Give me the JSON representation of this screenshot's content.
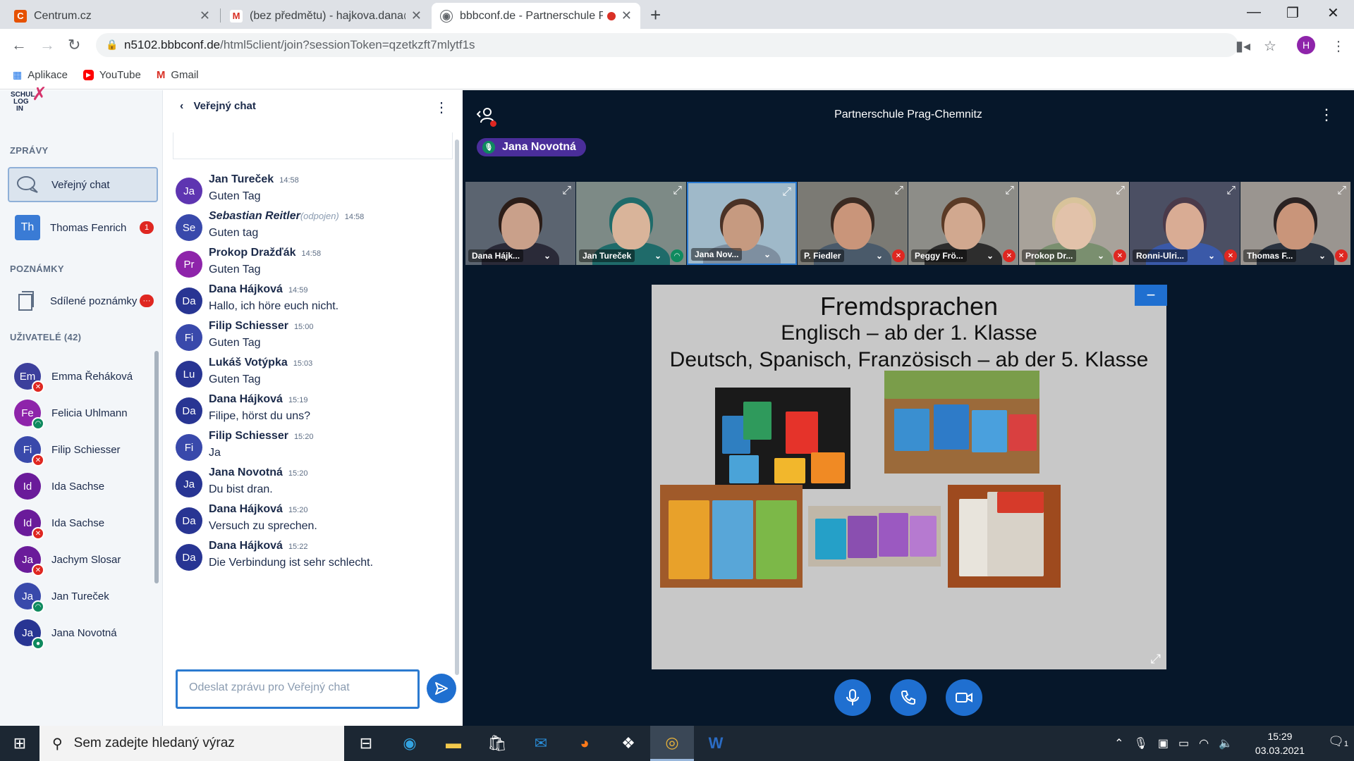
{
  "browser": {
    "tabs": [
      {
        "title": "Centrum.cz"
      },
      {
        "title": "(bez předmětu) - hajkova.dana@"
      },
      {
        "title": "bbbconf.de - Partnerschule P"
      }
    ],
    "url_host": "n5102.bbbconf.de",
    "url_path": "/html5client/join?sessionToken=qzetkzft7mlytf1s",
    "profile_initial": "H",
    "bookmarks": [
      "Aplikace",
      "YouTube",
      "Gmail"
    ]
  },
  "sidebar": {
    "logo_text": [
      "SCHUL",
      "LOG",
      "IN"
    ],
    "messages_title": "ZPRÁVY",
    "public_chat": "Veřejný chat",
    "private_chat": {
      "initials": "Th",
      "name": "Thomas Fenrich",
      "unread": "1"
    },
    "notes_title": "POZNÁMKY",
    "shared_notes": "Sdílené poznámky",
    "shared_notes_badge": "···",
    "users_title": "UŽIVATELÉ (42)",
    "users": [
      {
        "initials": "Em",
        "name": "Emma Řeháková",
        "status": "muted",
        "color": "#3c3f9c"
      },
      {
        "initials": "Fe",
        "name": "Felicia Uhlmann",
        "status": "listen",
        "color": "#8e24aa"
      },
      {
        "initials": "Fi",
        "name": "Filip Schiesser",
        "status": "muted",
        "color": "#3949ab"
      },
      {
        "initials": "Id",
        "name": "Ida Sachse",
        "status": "none",
        "color": "#6a1b9a"
      },
      {
        "initials": "Id",
        "name": "Ida Sachse",
        "status": "muted",
        "color": "#6a1b9a"
      },
      {
        "initials": "Ja",
        "name": "Jachym Slosar",
        "status": "muted",
        "color": "#6a1b9a"
      },
      {
        "initials": "Ja",
        "name": "Jan Tureček",
        "status": "listen",
        "color": "#3949ab"
      },
      {
        "initials": "Ja",
        "name": "Jana Novotná",
        "status": "talk",
        "color": "#283593"
      }
    ]
  },
  "chat": {
    "title": "Veřejný chat",
    "messages": [
      {
        "initials": "Ja",
        "name": "Jan Tureček",
        "time": "14:58",
        "text": "Guten Tag",
        "color": "#5e35b1",
        "offline": false
      },
      {
        "initials": "Se",
        "name": "Sebastian Reitler",
        "offline_tag": "(odpojen)",
        "time": "14:58",
        "text": "Guten tag",
        "color": "#3949ab",
        "offline": true
      },
      {
        "initials": "Pr",
        "name": "Prokop Dražďák",
        "time": "14:58",
        "text": "Guten Tag",
        "color": "#8e24aa",
        "offline": false
      },
      {
        "initials": "Da",
        "name": "Dana Hájková",
        "time": "14:59",
        "text": "Hallo, ich höre euch nicht.",
        "color": "#283593",
        "offline": false
      },
      {
        "initials": "Fi",
        "name": "Filip Schiesser",
        "time": "15:00",
        "text": "Guten Tag",
        "color": "#3949ab",
        "offline": false
      },
      {
        "initials": "Lu",
        "name": "Lukáš Votýpka",
        "time": "15:03",
        "text": "Guten Tag",
        "color": "#283593",
        "offline": false
      },
      {
        "initials": "Da",
        "name": "Dana Hájková",
        "time": "15:19",
        "text": "Filipe, hörst du uns?",
        "color": "#283593",
        "offline": false
      },
      {
        "initials": "Fi",
        "name": "Filip Schiesser",
        "time": "15:20",
        "text": "Ja",
        "color": "#3949ab",
        "offline": false
      },
      {
        "initials": "Ja",
        "name": "Jana Novotná",
        "time": "15:20",
        "text": "Du bist dran.",
        "color": "#283593",
        "offline": false
      },
      {
        "initials": "Da",
        "name": "Dana Hájková",
        "time": "15:20",
        "text": "Versuch zu sprechen.",
        "color": "#283593",
        "offline": false
      },
      {
        "initials": "Da",
        "name": "Dana Hájková",
        "time": "15:22",
        "text": "Die Verbindung ist sehr schlecht.",
        "color": "#283593",
        "offline": false
      }
    ],
    "input_placeholder": "Odeslat zprávu pro Veřejný chat"
  },
  "meeting": {
    "title": "Partnerschule Prag-Chemnitz",
    "talking": "Jana Novotná",
    "videos": [
      {
        "label": "Dana Hájk...",
        "status": "none",
        "bg": "#5b6470",
        "skin": "#c9a08a",
        "hair": "#2b1d18",
        "shirt": "#2a2a38"
      },
      {
        "label": "Jan Tureček",
        "status": "listen",
        "bg": "#7d8a86",
        "skin": "#d9b49a",
        "hair": "#1f6b6a",
        "shirt": "#1f6b6a"
      },
      {
        "label": "Jana Nov...",
        "status": "none",
        "bg": "#9fb9c9",
        "skin": "#c69a80",
        "hair": "#4a3226",
        "shirt": "#7e8fa0",
        "active": true
      },
      {
        "label": "P. Fiedler",
        "status": "muted",
        "bg": "#7b7a74",
        "skin": "#c9957a",
        "hair": "#3a2a22",
        "shirt": "#4a5a6a"
      },
      {
        "label": "Peggy Frö...",
        "status": "muted",
        "bg": "#8d8d88",
        "skin": "#d1a88f",
        "hair": "#5a3a26",
        "shirt": "#2d2d2d"
      },
      {
        "label": "Prokop Dr...",
        "status": "muted",
        "bg": "#a8a29a",
        "skin": "#e2c2aa",
        "hair": "#d8c39a",
        "shirt": "#7a8f6f"
      },
      {
        "label": "Ronni-Ulri...",
        "status": "muted",
        "bg": "#4b4f63",
        "skin": "#d9ac94",
        "hair": "#4a3a4a",
        "shirt": "#3a59a8"
      },
      {
        "label": "Thomas F...",
        "status": "muted",
        "bg": "#9a9590",
        "skin": "#c9957a",
        "hair": "#2a2222",
        "shirt": "#2a3340"
      }
    ],
    "slide": {
      "title": "Fremdsprachen",
      "line1": "Englisch – ab der 1. Klasse",
      "line2": "Deutsch, Spanisch, Französisch – ab der 5. Klasse",
      "minimize": "−"
    }
  },
  "taskbar": {
    "search_placeholder": "Sem zadejte hledaný výraz",
    "time": "15:29",
    "date": "03.03.2021",
    "notifications": "1"
  }
}
